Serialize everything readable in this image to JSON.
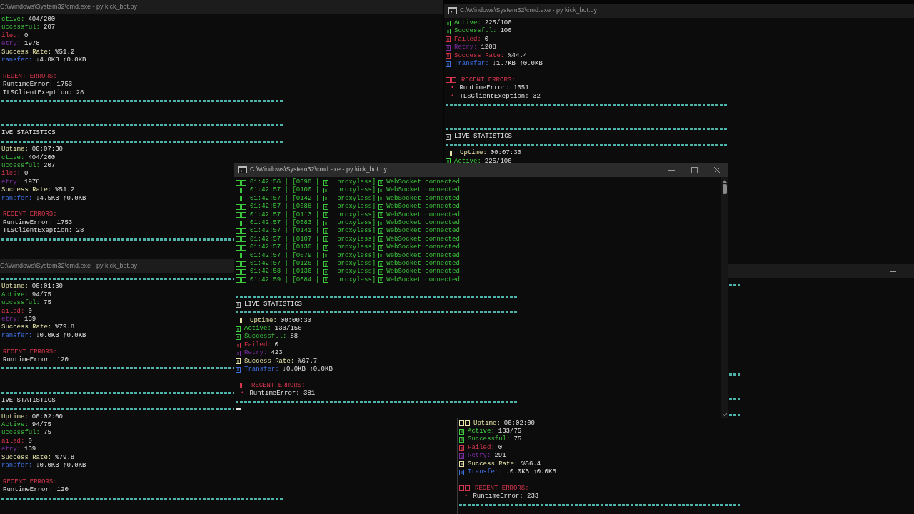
{
  "windows": [
    {
      "title": "C:\\Windows\\System32\\cmd.exe - py kick_bot.py",
      "active": false,
      "lines": [
        {
          "kind": "active",
          "label": "ctive:",
          "value": "404/200"
        },
        {
          "kind": "successful",
          "label": "uccessful:",
          "value": "207"
        },
        {
          "kind": "failed",
          "label": "iled:",
          "value": "0"
        },
        {
          "kind": "retry",
          "label": "etry:",
          "value": "1978"
        },
        {
          "kind": "rate",
          "label": "Success Rate:",
          "value": "%51.2"
        },
        {
          "kind": "transfer",
          "label": "ransfer:",
          "value": "↓4.0KB ↑0.0KB"
        },
        {
          "kind": "blank"
        },
        {
          "kind": "errors",
          "label": "RECENT ERRORS:"
        },
        {
          "kind": "error",
          "text": "RuntimeError: 1753"
        },
        {
          "kind": "error",
          "text": "TLSClientExeption: 28"
        },
        {
          "kind": "rule"
        },
        {
          "kind": "blank"
        },
        {
          "kind": "blank"
        },
        {
          "kind": "rule"
        },
        {
          "kind": "heading",
          "text": "IVE STATISTICS"
        },
        {
          "kind": "rule"
        },
        {
          "kind": "uptime",
          "label": "Uptime:",
          "value": "00:07:30"
        },
        {
          "kind": "active",
          "label": "ctive:",
          "value": "404/200"
        },
        {
          "kind": "successful",
          "label": "uccessful:",
          "value": "207"
        },
        {
          "kind": "failed",
          "label": "iled:",
          "value": "0"
        },
        {
          "kind": "retry",
          "label": "etry:",
          "value": "1978"
        },
        {
          "kind": "rate",
          "label": "Success Rate:",
          "value": "%51.2"
        },
        {
          "kind": "transfer",
          "label": "ransfer:",
          "value": "↓4.5KB ↑0.0KB"
        },
        {
          "kind": "blank"
        },
        {
          "kind": "errors",
          "label": "RECENT ERRORS:"
        },
        {
          "kind": "error",
          "text": "RuntimeError: 1753"
        },
        {
          "kind": "error",
          "text": "TLSClientExeption: 28"
        },
        {
          "kind": "rule"
        }
      ]
    },
    {
      "title": "C:\\Windows\\System32\\cmd.exe - py kick_bot.py",
      "icon": true,
      "active": false,
      "controls": [
        {
          "kind": "minimize"
        }
      ],
      "lines": [
        {
          "kind": "active",
          "icon": true,
          "label": "Active:",
          "value": "225/100"
        },
        {
          "kind": "successful",
          "icon": true,
          "label": "Successful:",
          "value": "100"
        },
        {
          "kind": "failed",
          "icon": true,
          "label": "Failed:",
          "value": "0"
        },
        {
          "kind": "retry",
          "icon": true,
          "label": "Retry:",
          "value": "1208"
        },
        {
          "kind": "rate",
          "icon": true,
          "alert": true,
          "label": "Success Rate:",
          "value": "%44.4"
        },
        {
          "kind": "transfer",
          "icon": true,
          "label": "Transfer:",
          "value": "↓1.7KB ↑0.0KB"
        },
        {
          "kind": "blank"
        },
        {
          "kind": "errors",
          "icon": true,
          "label": "RECENT ERRORS:"
        },
        {
          "kind": "error",
          "bullet": "•",
          "text": "RuntimeError: 1051"
        },
        {
          "kind": "error",
          "bullet": "•",
          "text": "TLSClientExeption: 32"
        },
        {
          "kind": "rule"
        },
        {
          "kind": "blank"
        },
        {
          "kind": "blank"
        },
        {
          "kind": "rule"
        },
        {
          "kind": "heading",
          "icon": true,
          "text": "LIVE STATISTICS"
        },
        {
          "kind": "rule"
        },
        {
          "kind": "uptime",
          "icon": true,
          "label": "Uptime:",
          "value": "00:07:30"
        },
        {
          "kind": "active",
          "icon": true,
          "label": "Active:",
          "value": "225/100"
        }
      ]
    },
    {
      "title": "C:\\Windows\\System32\\cmd.exe - py kick_bot.py",
      "icon": true,
      "active": true,
      "controls": [
        {
          "kind": "minimize"
        },
        {
          "kind": "maximize"
        },
        {
          "kind": "close"
        }
      ],
      "scrollbar": true,
      "cursor": true,
      "lines": [
        {
          "kind": "log",
          "time": "01:42:56 | [0090 |",
          "tag": "proxyless]",
          "message": "WebSocket connected"
        },
        {
          "kind": "log",
          "time": "01:42:57 | [0100 |",
          "tag": "proxyless]",
          "message": "WebSocket connected"
        },
        {
          "kind": "log",
          "time": "01:42:57 | [0142 |",
          "tag": "proxyless]",
          "message": "WebSocket connected"
        },
        {
          "kind": "log",
          "time": "01:42:57 | [0088 |",
          "tag": "proxyless]",
          "message": "WebSocket connected"
        },
        {
          "kind": "log",
          "time": "01:42:57 | [0113 |",
          "tag": "proxyless]",
          "message": "WebSocket connected"
        },
        {
          "kind": "log",
          "time": "01:42:57 | [0083 |",
          "tag": "proxyless]",
          "message": "WebSocket connected"
        },
        {
          "kind": "log",
          "time": "01:42:57 | [0141 |",
          "tag": "proxyless]",
          "message": "WebSocket connected"
        },
        {
          "kind": "log",
          "time": "01:42:57 | [0107 |",
          "tag": "proxyless]",
          "message": "WebSocket connected"
        },
        {
          "kind": "log",
          "time": "01:42:57 | [0130 |",
          "tag": "proxyless]",
          "message": "WebSocket connected"
        },
        {
          "kind": "log",
          "time": "01:42:57 | [0079 |",
          "tag": "proxyless]",
          "message": "WebSocket connected"
        },
        {
          "kind": "log",
          "time": "01:42:57 | [0126 |",
          "tag": "proxyless]",
          "message": "WebSocket connected"
        },
        {
          "kind": "log",
          "time": "01:42:58 | [0136 |",
          "tag": "proxyless]",
          "message": "WebSocket connected"
        },
        {
          "kind": "log",
          "time": "01:42:59 | [0084 |",
          "tag": "proxyless]",
          "message": "WebSocket connected"
        },
        {
          "kind": "blank"
        },
        {
          "kind": "rule"
        },
        {
          "kind": "heading",
          "icon": true,
          "text": "LIVE STATISTICS"
        },
        {
          "kind": "rule"
        },
        {
          "kind": "uptime",
          "icon": true,
          "label": "Uptime:",
          "value": "00:00:30"
        },
        {
          "kind": "active",
          "icon": true,
          "label": "Active:",
          "value": "130/150"
        },
        {
          "kind": "successful",
          "icon": true,
          "label": "Successful:",
          "value": "88"
        },
        {
          "kind": "failed",
          "icon": true,
          "label": "Failed:",
          "value": "0"
        },
        {
          "kind": "retry",
          "icon": true,
          "label": "Retry:",
          "value": "423"
        },
        {
          "kind": "rate",
          "icon": true,
          "label": "Success Rate:",
          "value": "%67.7"
        },
        {
          "kind": "transfer",
          "icon": true,
          "label": "Transfer:",
          "value": "↓0.0KB ↑0.0KB"
        },
        {
          "kind": "blank"
        },
        {
          "kind": "errors",
          "icon": true,
          "label": "RECENT ERRORS:"
        },
        {
          "kind": "error",
          "bullet": "•",
          "text": "RuntimeError: 381"
        },
        {
          "kind": "rule"
        }
      ]
    },
    {
      "title": "C:\\Windows\\System32\\cmd.exe - py kick_bot.py",
      "active": false,
      "lines": [
        {
          "kind": "rule"
        },
        {
          "kind": "uptime",
          "label": "Uptime:",
          "value": "00:01:30"
        },
        {
          "kind": "active",
          "label": "Active:",
          "value": "94/75"
        },
        {
          "kind": "successful",
          "label": "uccessful:",
          "value": "75"
        },
        {
          "kind": "failed",
          "label": "ailed:",
          "value": "0"
        },
        {
          "kind": "retry",
          "label": "etry:",
          "value": "139"
        },
        {
          "kind": "rate",
          "label": "Success Rate:",
          "value": "%79.8"
        },
        {
          "kind": "transfer",
          "label": "ransfer:",
          "value": "↓0.0KB ↑0.0KB"
        },
        {
          "kind": "blank"
        },
        {
          "kind": "errors",
          "label": "RECENT ERRORS:"
        },
        {
          "kind": "error",
          "text": "RuntimeError: 120"
        },
        {
          "kind": "rule"
        },
        {
          "kind": "blank"
        },
        {
          "kind": "blank"
        },
        {
          "kind": "rule"
        },
        {
          "kind": "heading",
          "text": "IVE STATISTICS"
        },
        {
          "kind": "rule"
        },
        {
          "kind": "uptime",
          "label": "Uptime:",
          "value": "00:02:00"
        },
        {
          "kind": "active",
          "label": "Active:",
          "value": "94/75"
        },
        {
          "kind": "successful",
          "label": "uccessful:",
          "value": "75"
        },
        {
          "kind": "failed",
          "label": "ailed:",
          "value": "0"
        },
        {
          "kind": "retry",
          "label": "etry:",
          "value": "139"
        },
        {
          "kind": "rate",
          "label": "Success Rate:",
          "value": "%79.8"
        },
        {
          "kind": "transfer",
          "label": "ransfer:",
          "value": "↓0.0KB ↑0.0KB"
        },
        {
          "kind": "blank"
        },
        {
          "kind": "errors",
          "label": "RECENT ERRORS:"
        },
        {
          "kind": "error",
          "text": "RuntimeError: 120"
        },
        {
          "kind": "rule"
        }
      ]
    },
    {
      "active": false,
      "controls": [
        {
          "kind": "minimize"
        }
      ],
      "lines": [
        {
          "kind": "rule"
        },
        {
          "kind": "blank"
        },
        {
          "kind": "blank"
        },
        {
          "kind": "blank"
        },
        {
          "kind": "blank"
        },
        {
          "kind": "blank"
        },
        {
          "kind": "blank"
        },
        {
          "kind": "blank"
        },
        {
          "kind": "blank"
        },
        {
          "kind": "blank"
        },
        {
          "kind": "blank"
        },
        {
          "kind": "rule"
        },
        {
          "kind": "blank"
        },
        {
          "kind": "blank"
        },
        {
          "kind": "rule"
        },
        {
          "kind": "blank"
        },
        {
          "kind": "rule"
        },
        {
          "kind": "uptime",
          "icon": true,
          "label": "Uptime:",
          "value": "00:02:00"
        },
        {
          "kind": "active",
          "icon": true,
          "label": "Active:",
          "value": "133/75"
        },
        {
          "kind": "successful",
          "icon": true,
          "label": "Successful:",
          "value": "75"
        },
        {
          "kind": "failed",
          "icon": true,
          "label": "Failed:",
          "value": "0"
        },
        {
          "kind": "retry",
          "icon": true,
          "label": "Retry:",
          "value": "291"
        },
        {
          "kind": "rate",
          "icon": true,
          "label": "Success Rate:",
          "value": "%56.4"
        },
        {
          "kind": "transfer",
          "icon": true,
          "label": "Transfer:",
          "value": "↓0.0KB ↑0.0KB"
        },
        {
          "kind": "blank"
        },
        {
          "kind": "errors",
          "icon": true,
          "label": "RECENT ERRORS:"
        },
        {
          "kind": "error",
          "bullet": "•",
          "text": "RuntimeError: 233"
        },
        {
          "kind": "rule"
        }
      ]
    }
  ]
}
